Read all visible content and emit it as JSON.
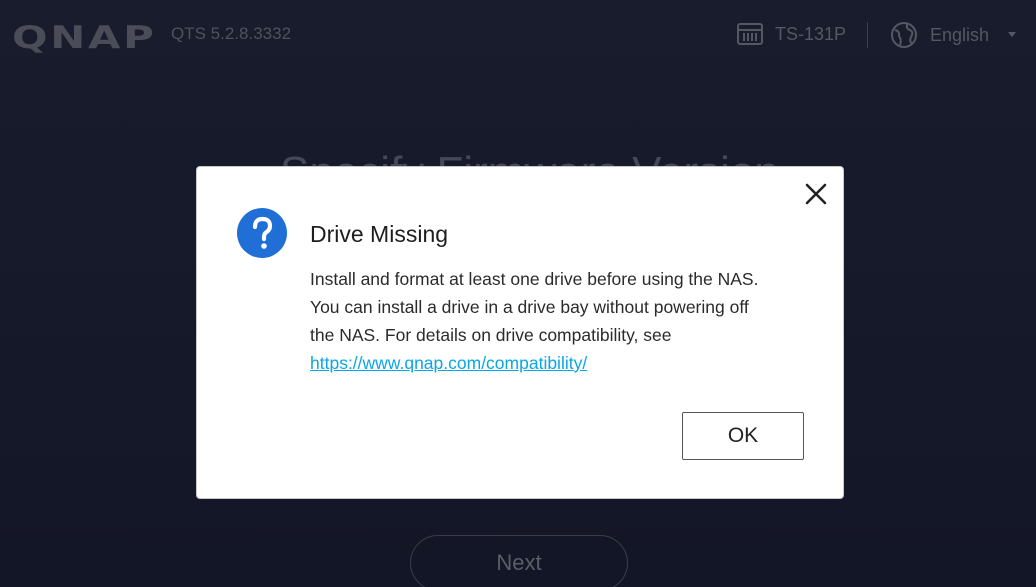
{
  "header": {
    "logo_text": "QNAP",
    "version": "QTS 5.2.8.3332",
    "model": "TS-131P",
    "language": "English"
  },
  "background": {
    "title": "Specify Firmware Version",
    "next_label": "Next"
  },
  "dialog": {
    "title": "Drive Missing",
    "body_line1": "Install and format at least one drive before using the NAS.",
    "body_line2": "You can install a drive in a drive bay without powering off",
    "body_line3": "the NAS. For details on drive compatibility, see",
    "link": "https://www.qnap.com/compatibility/",
    "ok_label": "OK"
  },
  "icons": {
    "header_model": "nas-device-icon",
    "header_language": "globe-icon",
    "dialog_status": "question-icon",
    "dialog_close": "close-icon"
  },
  "colors": {
    "accent_blue": "#1f6fd6",
    "link": "#0aa6e6",
    "background": "#161a2a"
  }
}
